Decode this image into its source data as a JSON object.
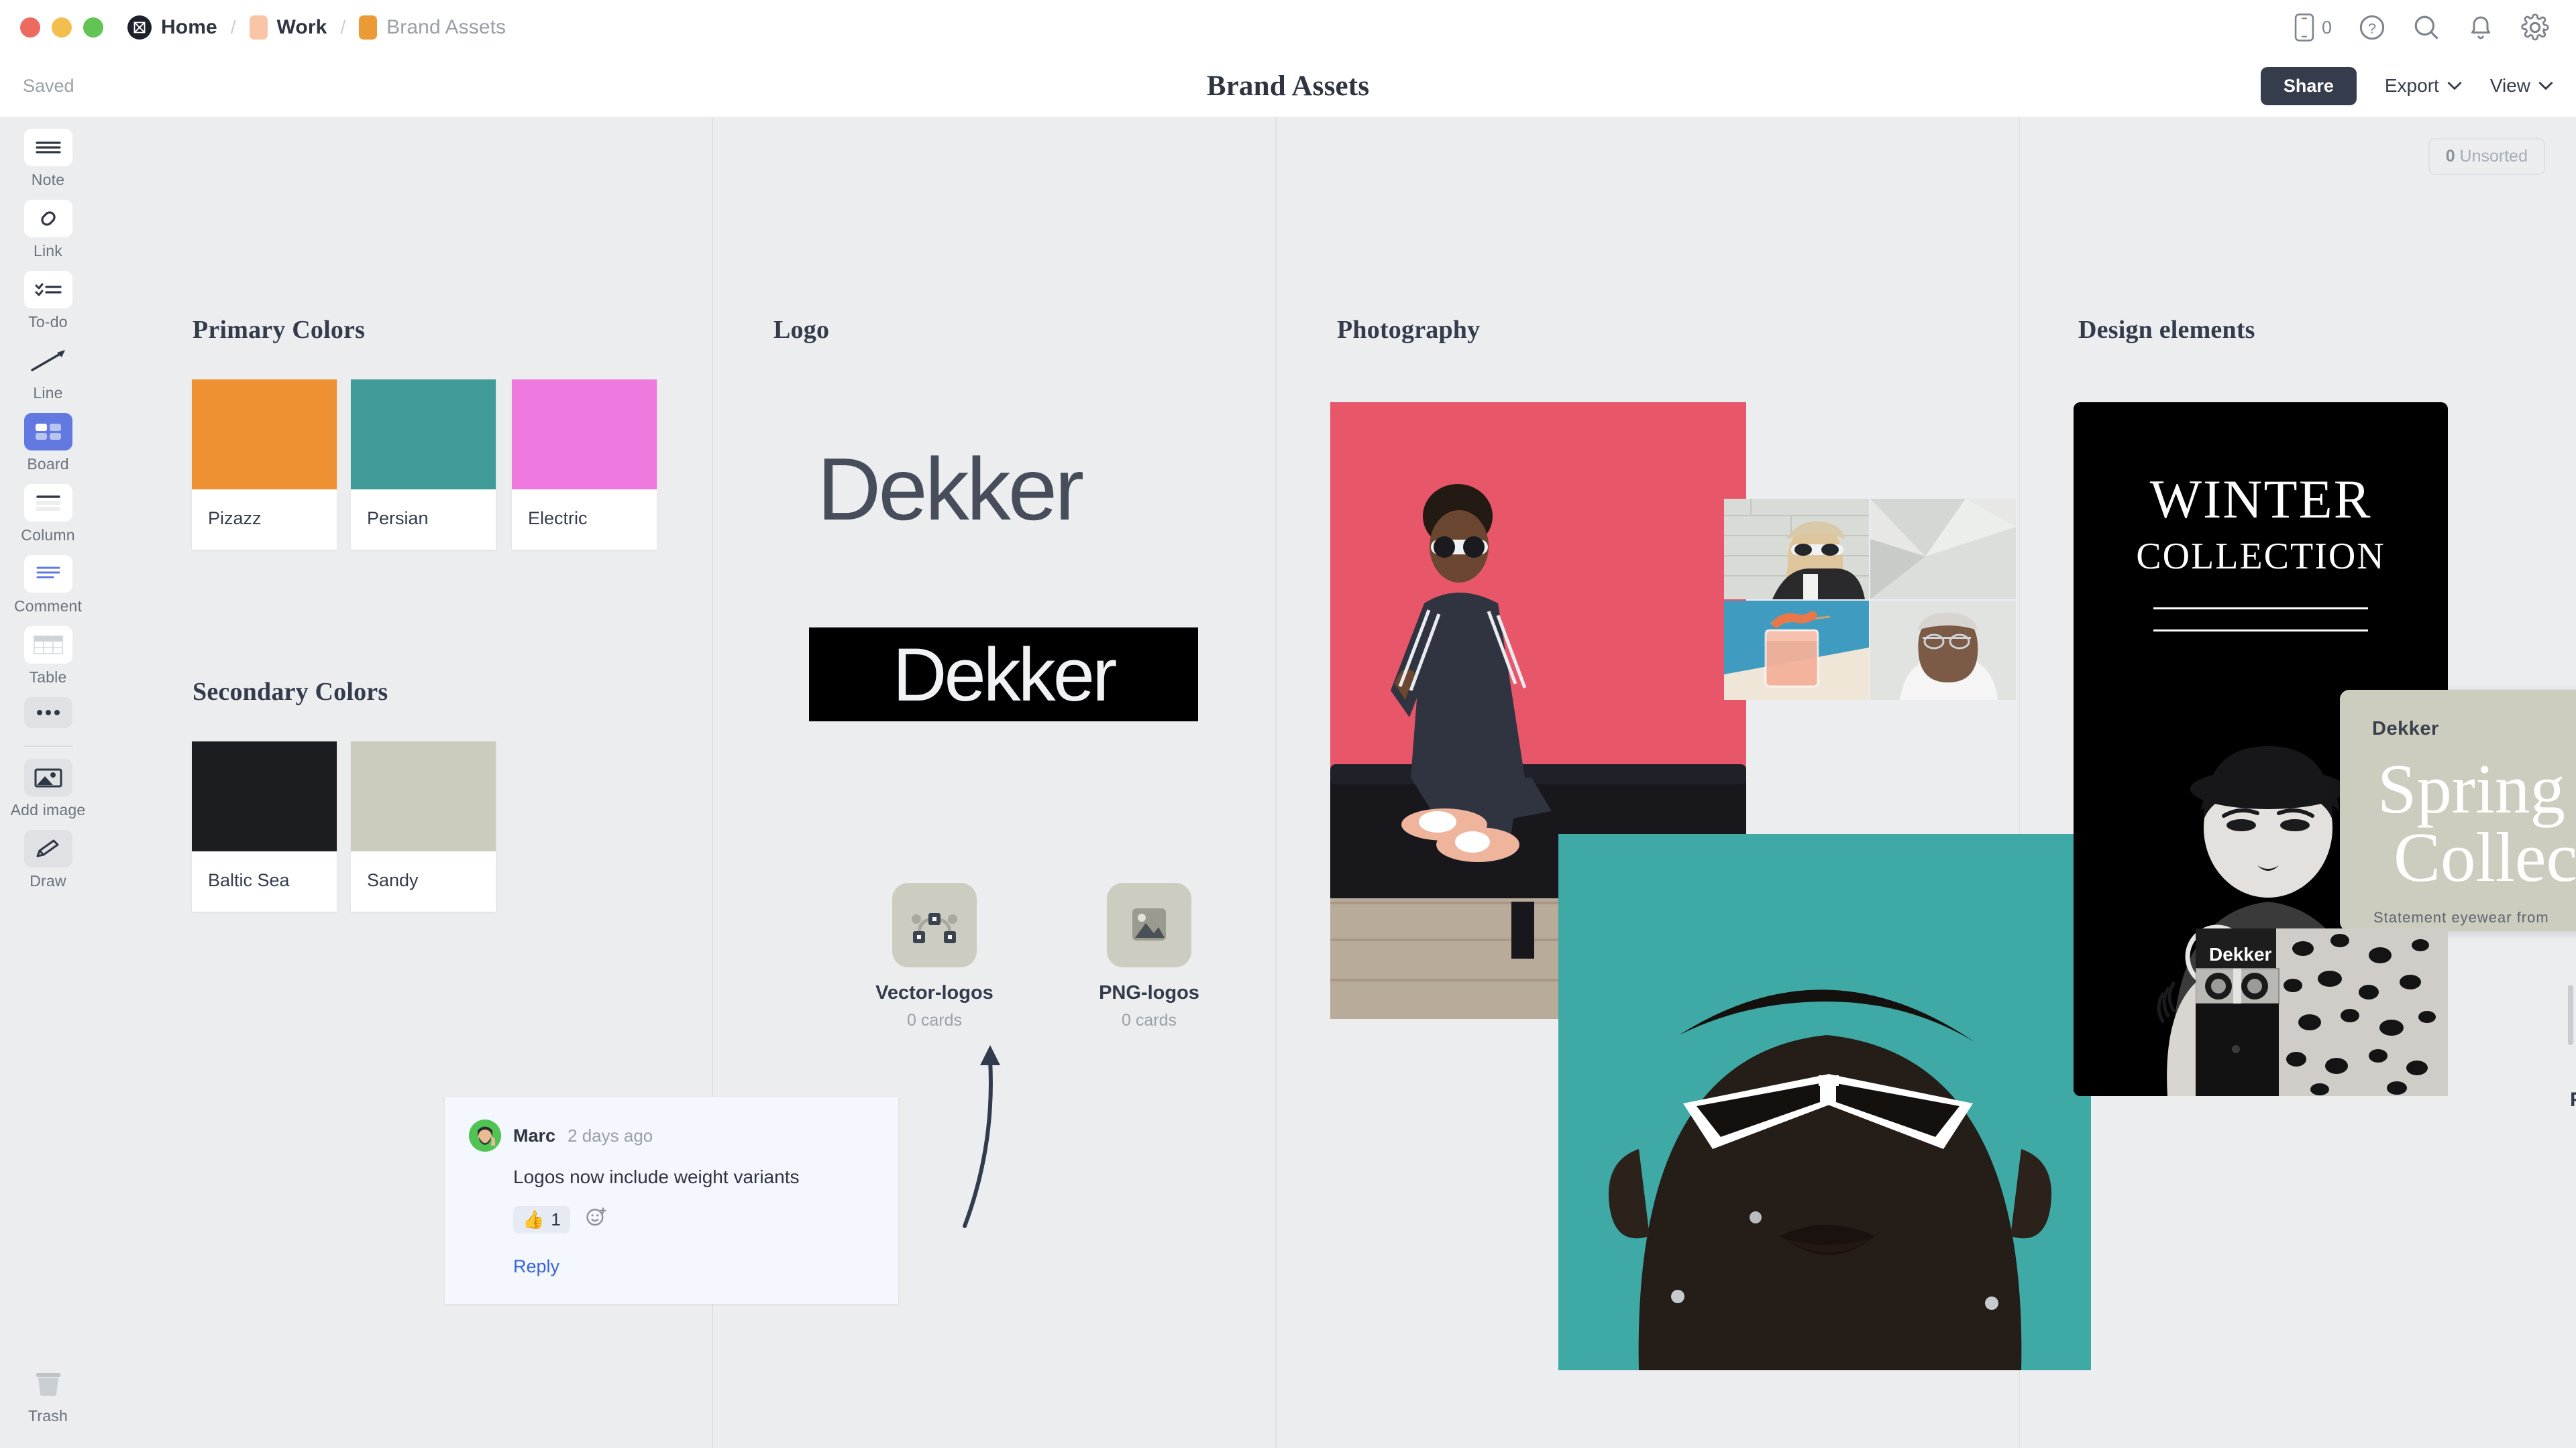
{
  "window": {
    "traffic_lights": [
      "close",
      "minimize",
      "maximize"
    ]
  },
  "breadcrumb": {
    "home_label": "Home",
    "work_label": "Work",
    "current_label": "Brand Assets"
  },
  "topbar_icons": {
    "device_count": "0",
    "device_icon": "mobile-device-icon",
    "help_icon": "help-circle-icon",
    "search_icon": "search-icon",
    "notifications_icon": "bell-icon",
    "settings_icon": "gear-icon"
  },
  "subbar": {
    "status": "Saved",
    "title": "Brand Assets",
    "share_label": "Share",
    "export_label": "Export",
    "view_label": "View"
  },
  "canvas": {
    "unsorted_count": "0",
    "unsorted_label": "Unsorted"
  },
  "sidebar": {
    "tools": [
      {
        "label": "Note",
        "icon": "note-icon",
        "active": false
      },
      {
        "label": "Link",
        "icon": "link-icon",
        "active": false
      },
      {
        "label": "To-do",
        "icon": "todo-icon",
        "active": false
      },
      {
        "label": "Line",
        "icon": "line-icon",
        "active": false
      },
      {
        "label": "Board",
        "icon": "board-icon",
        "active": true
      },
      {
        "label": "Column",
        "icon": "column-icon",
        "active": false
      },
      {
        "label": "Comment",
        "icon": "comment-icon",
        "active": false
      },
      {
        "label": "Table",
        "icon": "table-icon",
        "active": false
      }
    ],
    "more_label": "",
    "more_icon": "ellipsis-icon",
    "extras": [
      {
        "label": "Add image",
        "icon": "image-icon"
      },
      {
        "label": "Draw",
        "icon": "pencil-icon"
      }
    ],
    "trash": {
      "label": "Trash",
      "icon": "trash-icon"
    }
  },
  "sections": {
    "primary_colors": {
      "title": "Primary Colors",
      "swatches": [
        {
          "name": "Pizazz",
          "hex": "#ED9133"
        },
        {
          "name": "Persian",
          "hex": "#409B99"
        },
        {
          "name": "Electric",
          "hex": "#EE7AE0"
        }
      ]
    },
    "secondary_colors": {
      "title": "Secondary Colors",
      "swatches": [
        {
          "name": "Baltic Sea",
          "hex": "#1C1D20"
        },
        {
          "name": "Sandy",
          "hex": "#CCCCBE"
        }
      ]
    },
    "logo": {
      "title": "Logo",
      "wordmark_light": "Dekker",
      "wordmark_dark": "Dekker",
      "folders": [
        {
          "name": "Vector-logos",
          "count": "0 cards",
          "icon": "vector-path-icon"
        },
        {
          "name": "PNG-logos",
          "count": "0 cards",
          "icon": "image-placeholder-icon"
        }
      ]
    },
    "photography": {
      "title": "Photography"
    },
    "design_elements": {
      "title": "Design elements",
      "winter_poster": {
        "line1": "WINTER",
        "line2": "COLLECTION"
      },
      "spring_card": {
        "brand": "Dekker",
        "title_line1": "Spring",
        "title_line2": "Collection",
        "subtitle": "Statement eyewear from Denmark"
      },
      "belt_poster_brand": "Dekker",
      "cut_off_label": "Frast"
    }
  },
  "comment": {
    "author": "Marc",
    "time": "2 days ago",
    "text": "Logos now include weight variants",
    "reaction_emoji": "👍",
    "reaction_count": "1",
    "add_reaction_icon": "add-emoji-icon",
    "reply_label": "Reply"
  },
  "colors": {
    "canvas_bg": "#EBEDEF",
    "accent_dark": "#353D4D",
    "link_blue": "#3663D6",
    "tool_active": "#6179E0"
  }
}
